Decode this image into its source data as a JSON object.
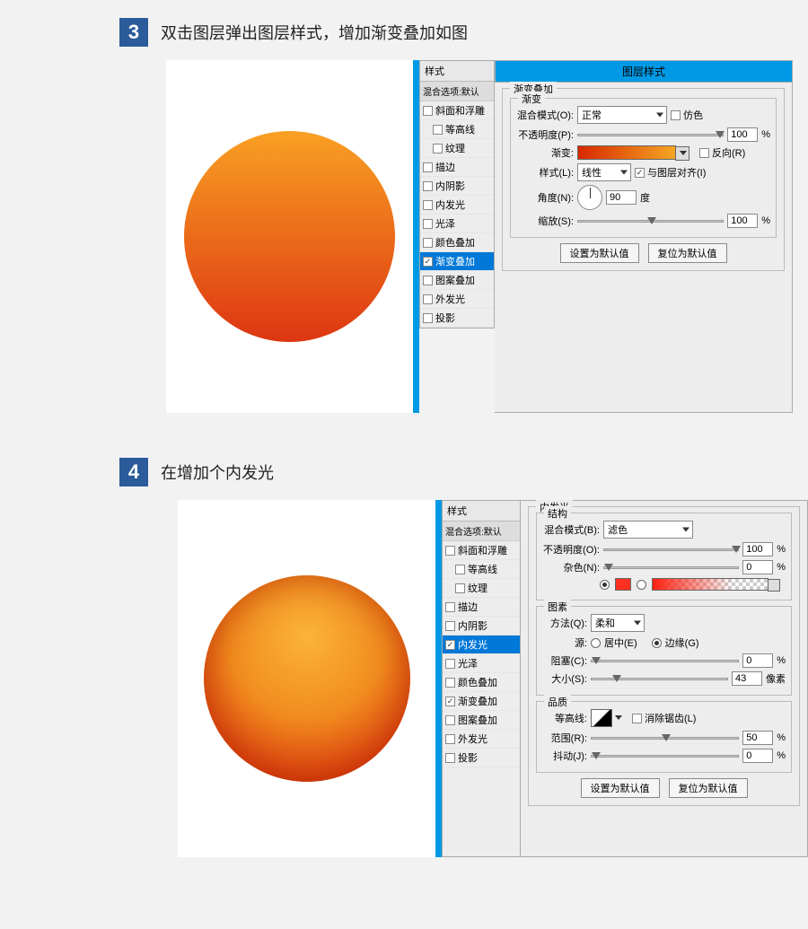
{
  "steps": {
    "s3": {
      "num": "3",
      "title": "双击图层弹出图层样式，增加渐变叠加如图"
    },
    "s4": {
      "num": "4",
      "title": "在增加个内发光"
    }
  },
  "dialog_title": "图层样式",
  "styles_header": "样式",
  "styles_sub": "混合选项:默认",
  "style_items": {
    "bevel": "斜面和浮雕",
    "contour": "等高线",
    "texture": "纹理",
    "stroke": "描边",
    "inner_shadow": "内阴影",
    "inner_glow": "内发光",
    "satin": "光泽",
    "color_overlay": "颜色叠加",
    "grad_overlay": "渐变叠加",
    "pattern_overlay": "图案叠加",
    "outer_glow": "外发光",
    "drop_shadow": "投影"
  },
  "grad_panel": {
    "title": "渐变叠加",
    "sub": "渐变",
    "blend_label": "混合模式(O):",
    "blend_value": "正常",
    "dither": "仿色",
    "opacity_label": "不透明度(P):",
    "opacity_value": "100",
    "grad_label": "渐变:",
    "reverse": "反向(R)",
    "style_label": "样式(L):",
    "style_value": "线性",
    "align": "与图层对齐(I)",
    "angle_label": "角度(N):",
    "angle_value": "90",
    "angle_unit": "度",
    "scale_label": "缩放(S):",
    "scale_value": "100",
    "set_default": "设置为默认值",
    "reset_default": "复位为默认值"
  },
  "glow_panel": {
    "title": "内发光",
    "struct": "结构",
    "blend_label": "混合模式(B):",
    "blend_value": "滤色",
    "opacity_label": "不透明度(O):",
    "opacity_value": "100",
    "noise_label": "杂色(N):",
    "noise_value": "0",
    "elements": "图素",
    "method_label": "方法(Q):",
    "method_value": "柔和",
    "source_label": "源:",
    "source_center": "居中(E)",
    "source_edge": "边缘(G)",
    "choke_label": "阻塞(C):",
    "choke_value": "0",
    "size_label": "大小(S):",
    "size_value": "43",
    "size_unit": "像素",
    "quality": "品质",
    "contour_label": "等高线:",
    "antialias": "消除锯齿(L)",
    "range_label": "范围(R):",
    "range_value": "50",
    "jitter_label": "抖动(J):",
    "jitter_value": "0",
    "set_default": "设置为默认值",
    "reset_default": "复位为默认值"
  },
  "pct": "%"
}
